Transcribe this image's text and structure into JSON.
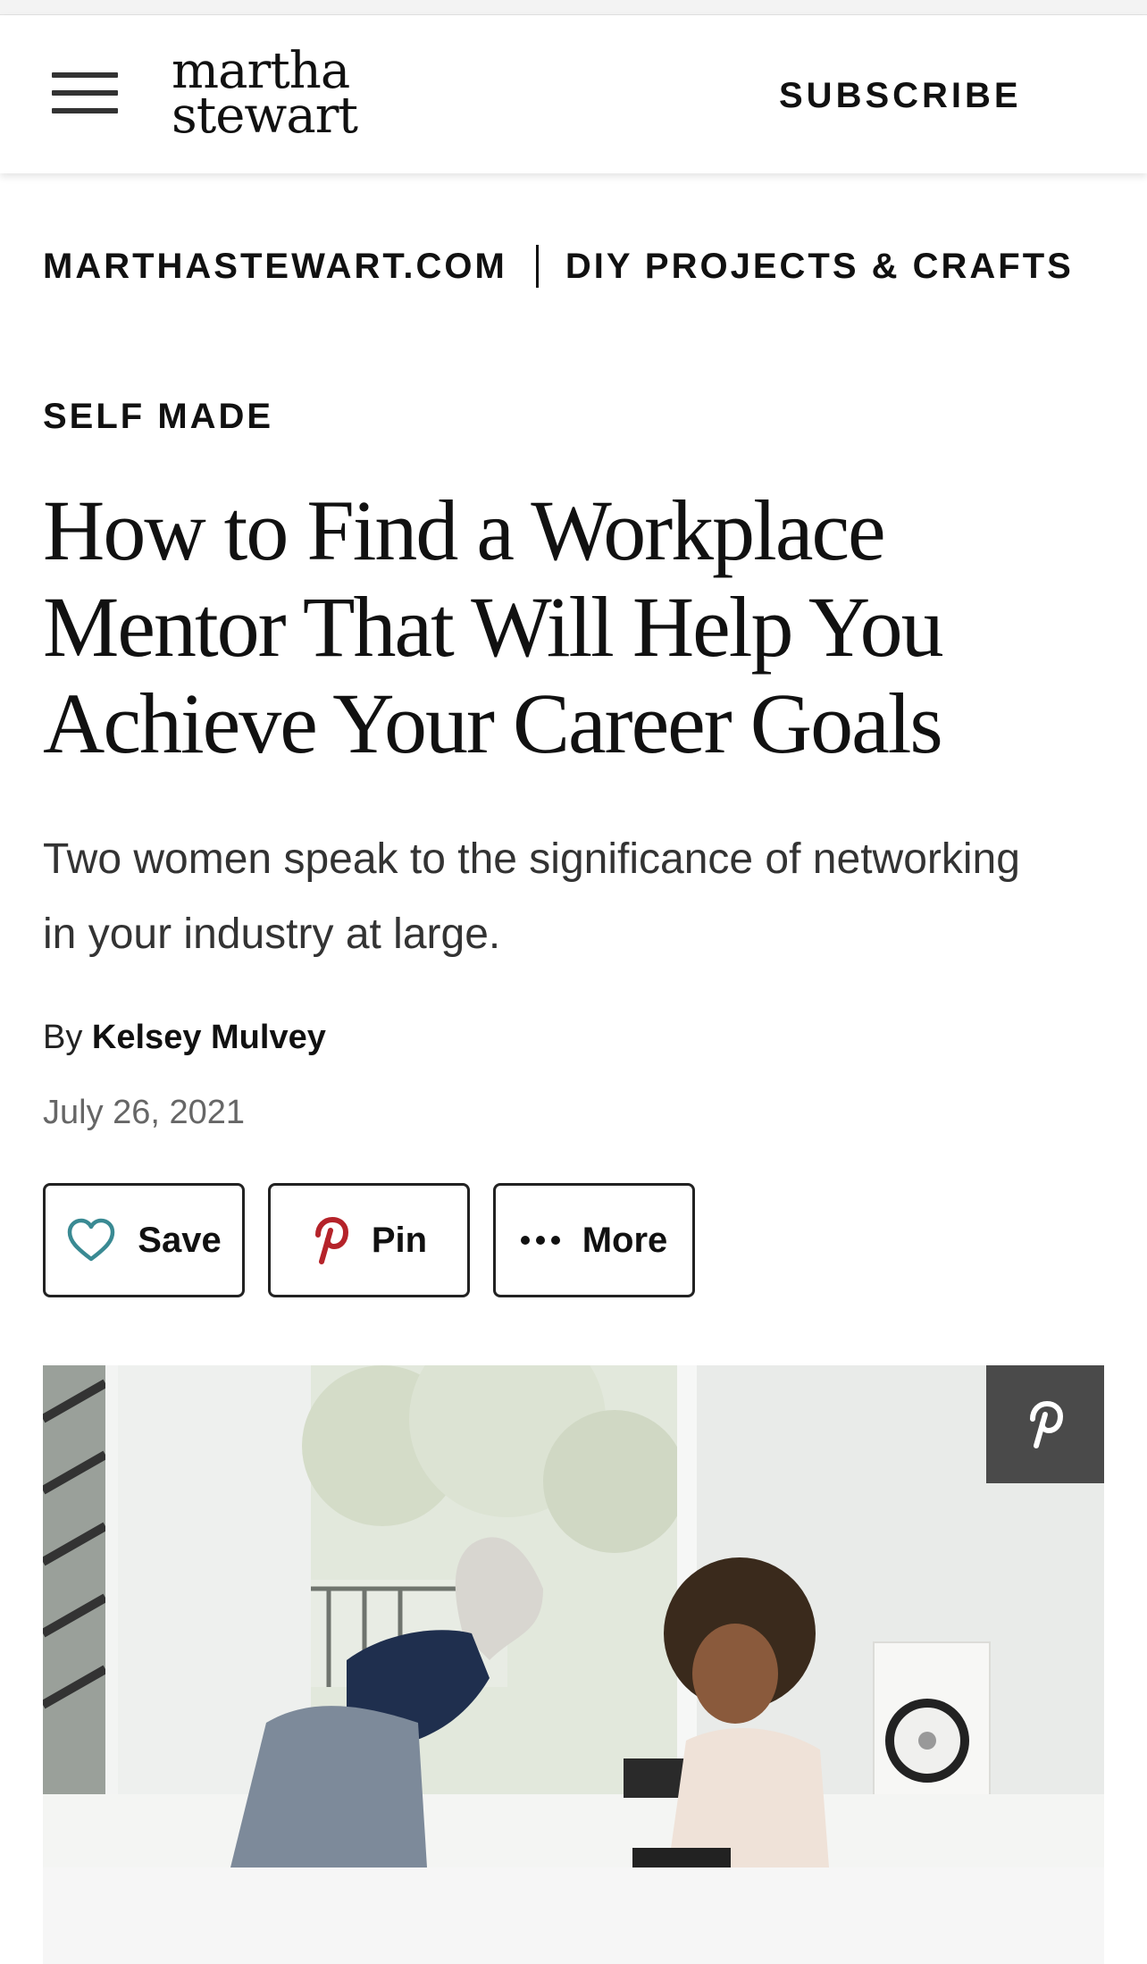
{
  "header": {
    "logo_line1": "martha",
    "logo_line2": "stewart",
    "subscribe_label": "SUBSCRIBE"
  },
  "breadcrumb": {
    "items": [
      "MARTHASTEWART.COM",
      "DIY PROJECTS & CRAFTS"
    ]
  },
  "article": {
    "kicker": "SELF MADE",
    "headline": "How to Find a Workplace Mentor That Will Help You Achieve Your Career Goals",
    "dek": "Two women speak to the significance of networking in your industry at large.",
    "byline_prefix": "By",
    "author": "Kelsey Mulvey",
    "date": "July 26, 2021"
  },
  "actions": {
    "save_label": "Save",
    "pin_label": "Pin",
    "more_label": "More"
  },
  "icons": {
    "menu": "hamburger-menu-icon",
    "save": "heart-icon",
    "pin": "pinterest-icon",
    "more": "more-dots-icon",
    "hero_pin": "pinterest-icon"
  },
  "colors": {
    "heart": "#3a8a93",
    "pinterest": "#b5232a",
    "pin_overlay_bg": "#4a4a4a",
    "text": "#111111"
  }
}
